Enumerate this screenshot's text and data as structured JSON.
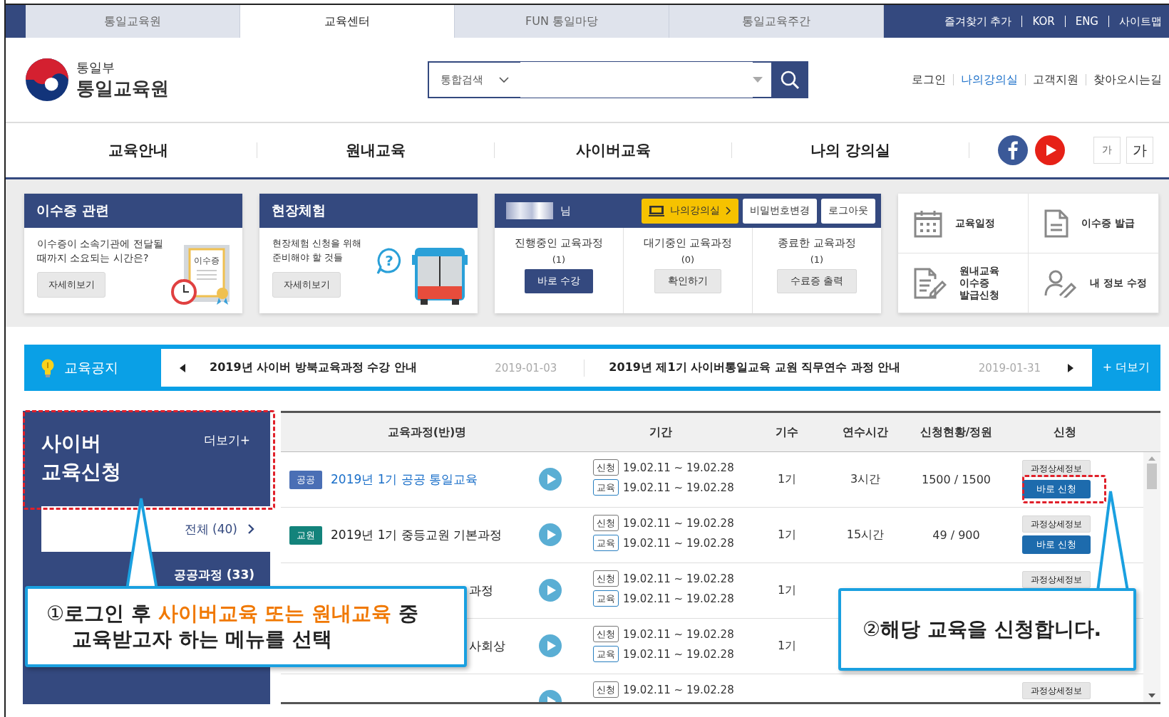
{
  "top_tabs": [
    {
      "label": "통일교육원",
      "selected": false
    },
    {
      "label": "교육센터",
      "selected": true
    },
    {
      "label": "FUN 통일마당",
      "selected": false
    },
    {
      "label": "통일교육주간",
      "selected": false
    }
  ],
  "top_links": [
    "즐겨찾기 추가",
    "KOR",
    "ENG",
    "사이트맵"
  ],
  "logo": {
    "ministry": "통일부",
    "name": "통일교육원"
  },
  "search": {
    "scope": "통합검색"
  },
  "user_links": [
    {
      "label": "로그인",
      "selected": false
    },
    {
      "label": "나의강의실",
      "selected": true
    },
    {
      "label": "고객지원",
      "selected": false
    },
    {
      "label": "찾아오시는길",
      "selected": false
    }
  ],
  "nav": [
    "교육안내",
    "원내교육",
    "사이버교육",
    "나의 강의실"
  ],
  "font_buttons": [
    "가",
    "가"
  ],
  "info_cards": [
    {
      "kind": "certificate",
      "title": "이수증 관련",
      "text": "이수증이 소속기관에 전달될 때까지 소요되는 시간은?",
      "button": "자세히보기",
      "art_label": "이수증"
    },
    {
      "kind": "bus",
      "title": "현장체험",
      "text": "현장체험 신청을 위해 준비해야 할 것들",
      "button": "자세히보기",
      "art_label": "?"
    }
  ],
  "user_panel": {
    "suffix": "님",
    "buttons": [
      {
        "label": "나의강의실",
        "kind": "classroom"
      },
      {
        "label": "비밀번호변경",
        "kind": "plain"
      },
      {
        "label": "로그아웃",
        "kind": "plain"
      }
    ],
    "columns": [
      {
        "label": "진행중인 교육과정",
        "count": "(1)",
        "button": "바로 수강",
        "primary": true
      },
      {
        "label": "대기중인 교육과정",
        "count": "(0)",
        "button": "확인하기",
        "primary": false
      },
      {
        "label": "종료한 교육과정",
        "count": "(1)",
        "button": "수료증 출력",
        "primary": false
      }
    ]
  },
  "quick_links": [
    {
      "kind": "calendar",
      "label": "교육일정"
    },
    {
      "kind": "document",
      "label": "이수증 발급"
    },
    {
      "kind": "doc-edit",
      "label": "원내교육\n이수증\n발급신청"
    },
    {
      "kind": "person-edit",
      "label": "내 정보 수정"
    }
  ],
  "notice": {
    "title": "교육공지",
    "items": [
      {
        "title": "2019년 사이버 방북교육과정 수강 안내",
        "date": "2019-01-03"
      },
      {
        "title": "2019년 제1기 사이버통일교육 교원 직무연수 과정 안내",
        "date": "2019-01-31"
      }
    ],
    "more": "+ 더보기"
  },
  "sidebar": {
    "title": [
      "사이버",
      "교육신청"
    ],
    "more": "더보기+",
    "items": [
      {
        "label": "전체 (40)",
        "selected": true
      },
      {
        "label": "공공과정 (33)",
        "selected": false
      }
    ]
  },
  "table": {
    "columns": [
      "교육과정(반)명",
      "기간",
      "기수",
      "연수시간",
      "신청현황/정원",
      "신청"
    ],
    "rows": [
      {
        "badge": {
          "label": "공공",
          "color": "#4a6fb5"
        },
        "name": "2019년 1기 공공 통일교육",
        "link": true,
        "clipped": false,
        "periods": [
          {
            "kind": "apply",
            "tag": "신청",
            "range": "19.02.11 ~ 19.02.28"
          },
          {
            "kind": "study",
            "tag": "교육",
            "range": "19.02.11 ~ 19.02.28"
          }
        ],
        "term": "1기",
        "hours": "3시간",
        "applicants": "1500 / 1500",
        "detail": "과정상세정보",
        "apply": "바로 신청"
      },
      {
        "badge": {
          "label": "교원",
          "color": "#13837b"
        },
        "name": "2019년 1기 중등교원 기본과정",
        "link": false,
        "clipped": false,
        "periods": [
          {
            "kind": "apply",
            "tag": "신청",
            "range": "19.02.11 ~ 19.02.28"
          },
          {
            "kind": "study",
            "tag": "교육",
            "range": "19.02.11 ~ 19.02.28"
          }
        ],
        "term": "1기",
        "hours": "15시간",
        "applicants": "49 / 900",
        "detail": "과정상세정보",
        "apply": "바로 신청"
      },
      {
        "name": "과정",
        "link": false,
        "clipped": true,
        "periods": [
          {
            "kind": "apply",
            "tag": "신청",
            "range": "19.02.11 ~ 19.02.28"
          },
          {
            "kind": "study",
            "tag": "교육",
            "range": "19.02.11 ~ 19.02.28"
          }
        ],
        "term": "1기",
        "detail": "과정상세정보"
      },
      {
        "name": "사회상",
        "link": false,
        "clipped": true,
        "periods": [
          {
            "kind": "apply",
            "tag": "신청",
            "range": "19.02.11 ~ 19.02.28"
          },
          {
            "kind": "study",
            "tag": "교육",
            "range": "19.02.11 ~ 19.02.28"
          }
        ],
        "term": "1기"
      },
      {
        "periods": [
          {
            "kind": "apply",
            "tag": "신청",
            "range": "19.02.11 ~ 19.02.28"
          }
        ],
        "detail": "과정상세정보"
      }
    ]
  },
  "callouts": [
    {
      "marker": "①",
      "segments": [
        {
          "text": "로그인 후 ",
          "highlight": false
        },
        {
          "text": "사이버교육 또는 원내교육",
          "highlight": true
        },
        {
          "text": " 중\n교육받고자 하는 메뉴를 선택",
          "highlight": false
        }
      ]
    },
    {
      "marker": "②",
      "segments": [
        {
          "text": "해당 교육을 신청합니다.",
          "highlight": false
        }
      ]
    }
  ]
}
